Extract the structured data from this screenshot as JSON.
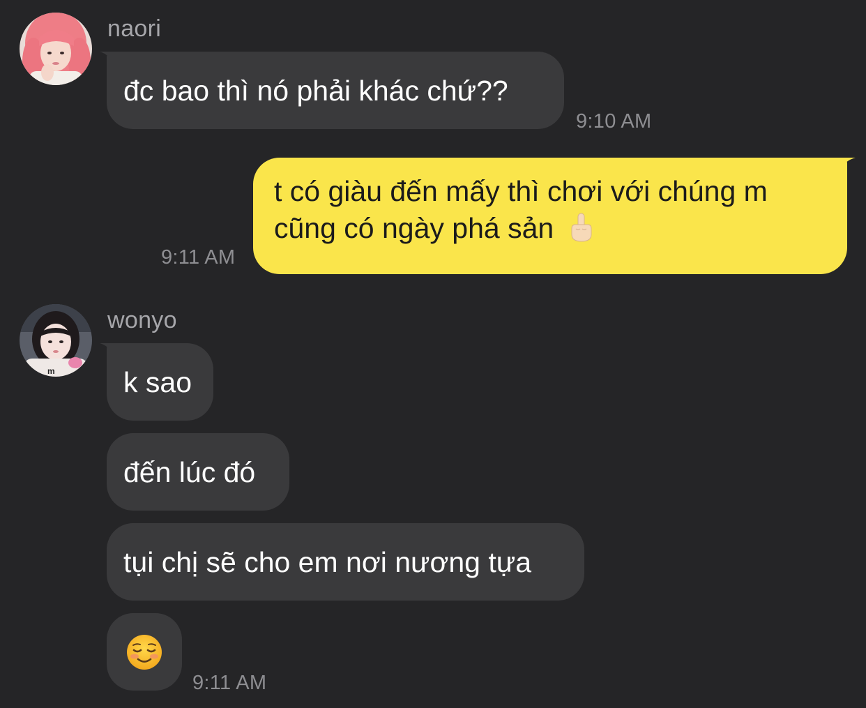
{
  "conversation": {
    "groups": [
      {
        "sender": "naori",
        "avatar_icon": "pink-hair-avatar",
        "messages": [
          {
            "text": "đc bao thì nó phải khác chứ??"
          }
        ],
        "time": "9:10 AM"
      },
      {
        "sender": "me",
        "messages": [
          {
            "line1": "t có giàu đến mấy thì chơi với chúng m",
            "line2": "cũng có ngày phá sản",
            "emoji": "middle-finger-emoji"
          }
        ],
        "time": "9:11 AM"
      },
      {
        "sender": "wonyo",
        "avatar_icon": "dark-hair-avatar",
        "messages": [
          {
            "text": "k sao"
          },
          {
            "text": "đến lúc đó"
          },
          {
            "text": "tụi chị sẽ cho em nơi nương tựa"
          },
          {
            "emoji": "smiling-face-emoji"
          }
        ],
        "time": "9:11 AM"
      }
    ]
  },
  "colors": {
    "background": "#252527",
    "incoming_bubble": "#3a3a3c",
    "outgoing_bubble": "#fae54b",
    "name_text": "#a6a6aa",
    "timestamp_text": "#8e8e92"
  }
}
